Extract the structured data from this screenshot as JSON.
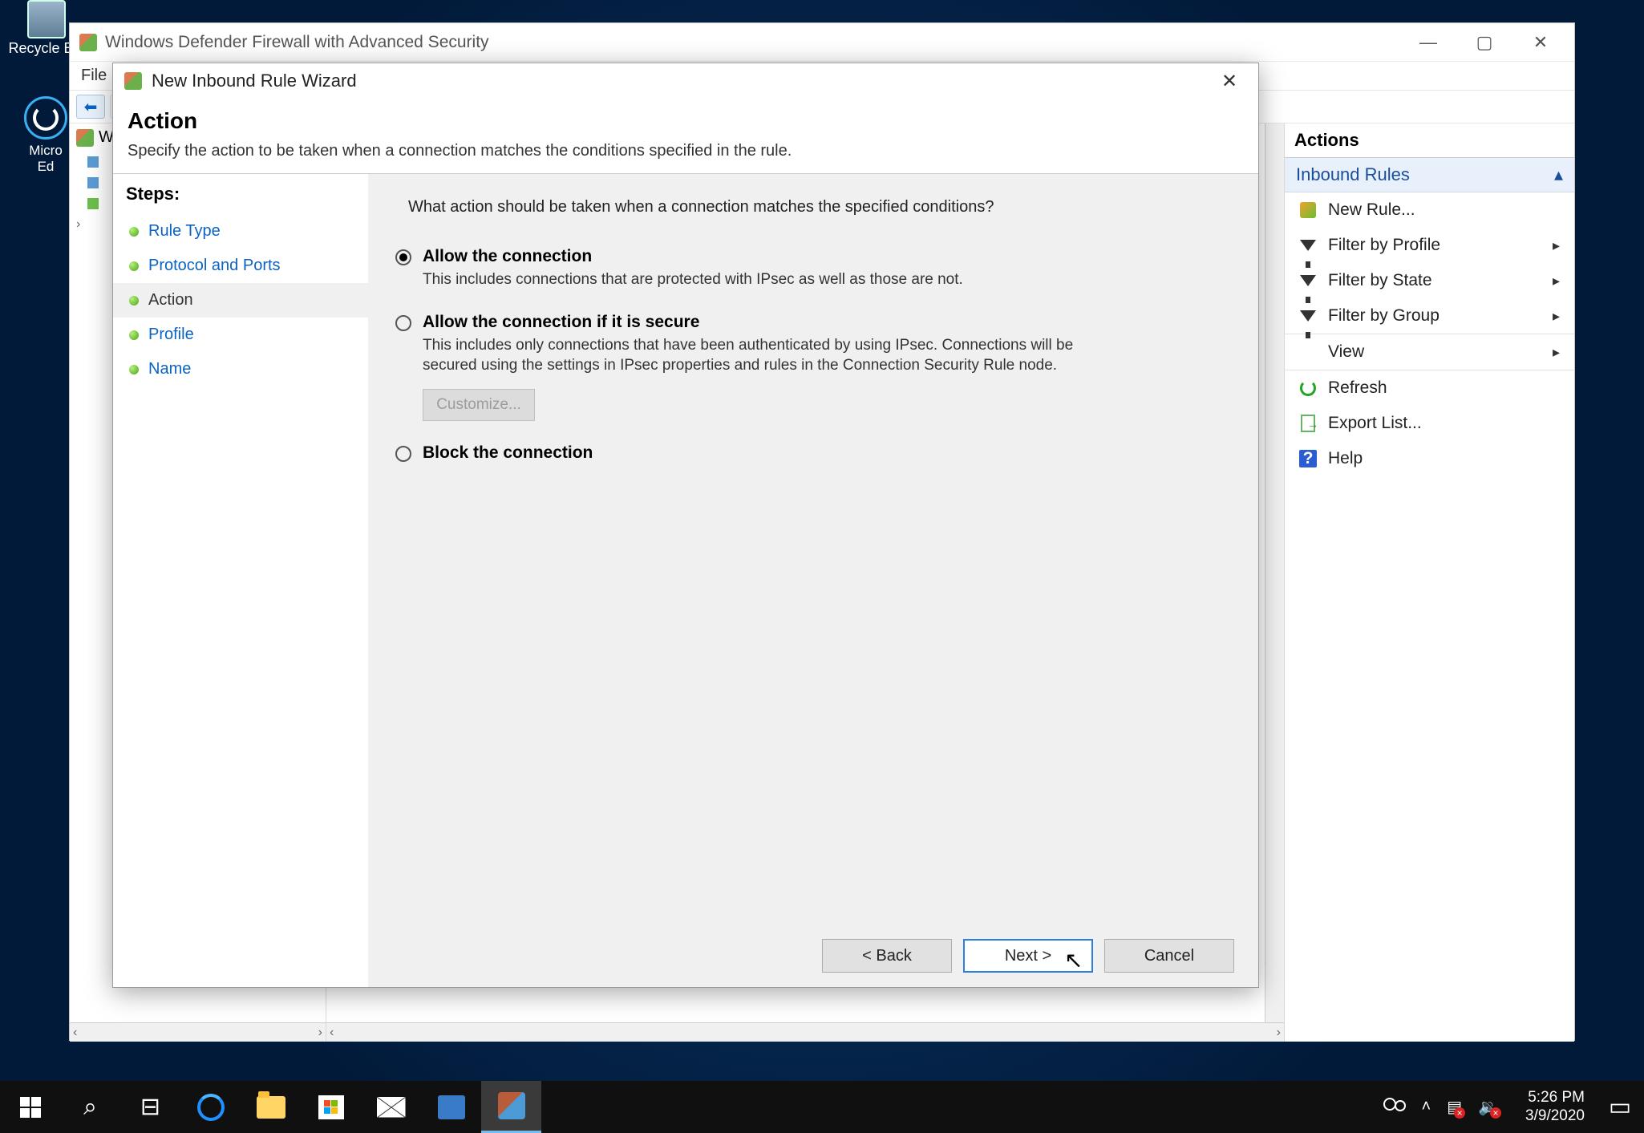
{
  "desktop": {
    "recycle_bin": "Recycle Bin",
    "edge": "Micro\nEd"
  },
  "parent_window": {
    "title": "Windows Defender Firewall with Advanced Security",
    "menu_file": "File",
    "tree_item": "W"
  },
  "actions_panel": {
    "header": "Actions",
    "section": "Inbound Rules",
    "items": {
      "new_rule": "New Rule...",
      "filter_profile": "Filter by Profile",
      "filter_state": "Filter by State",
      "filter_group": "Filter by Group",
      "view": "View",
      "refresh": "Refresh",
      "export": "Export List...",
      "help": "Help"
    }
  },
  "wizard": {
    "title": "New Inbound Rule Wizard",
    "heading": "Action",
    "subtitle": "Specify the action to be taken when a connection matches the conditions specified in the rule.",
    "steps_label": "Steps:",
    "steps": {
      "rule_type": "Rule Type",
      "protocol": "Protocol and Ports",
      "action": "Action",
      "profile": "Profile",
      "name": "Name"
    },
    "question": "What action should be taken when a connection matches the specified conditions?",
    "opt1_label": "Allow the connection",
    "opt1_desc": "This includes connections that are protected with IPsec as well as those are not.",
    "opt2_label": "Allow the connection if it is secure",
    "opt2_desc": "This includes only connections that have been authenticated by using IPsec.  Connections will be secured using the settings in IPsec properties and rules in the Connection Security Rule node.",
    "customize": "Customize...",
    "opt3_label": "Block the connection",
    "back": "< Back",
    "next": "Next >",
    "cancel": "Cancel"
  },
  "taskbar": {
    "time": "5:26 PM",
    "date": "3/9/2020"
  }
}
